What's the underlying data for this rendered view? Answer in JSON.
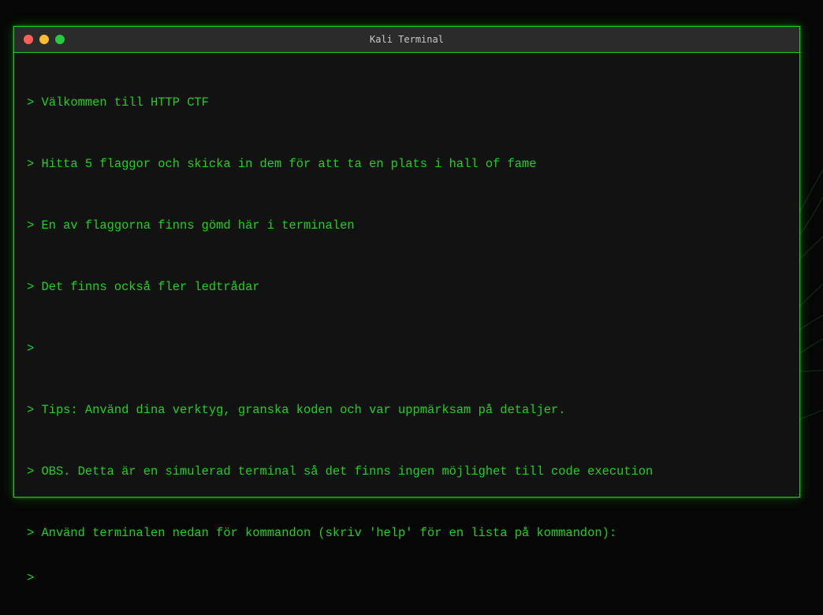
{
  "window": {
    "title": "Kali Terminal"
  },
  "terminal": {
    "lines": [
      "> Välkommen till HTTP CTF",
      "> Hitta 5 flaggor och skicka in dem för att ta en plats i hall of fame",
      "> En av flaggorna finns gömd här i terminalen",
      "> Det finns också fler ledtrådar",
      ">",
      "> Tips: Använd dina verktyg, granska koden och var uppmärksam på detaljer.",
      "> OBS. Detta är en simulerad terminal så det finns ingen möjlighet till code execution",
      "> Använd terminalen nedan för kommandon (skriv 'help' för en lista på kommandon):"
    ],
    "prompt": ">",
    "input_value": ""
  },
  "colors": {
    "accent": "#1fd11f",
    "window_bg": "#121212",
    "titlebar_bg": "#2b2b2b",
    "page_bg": "#060606"
  },
  "icons": {
    "close": "red-close-dot-icon",
    "minimize": "yellow-minimize-dot-icon",
    "maximize": "green-maximize-dot-icon"
  }
}
